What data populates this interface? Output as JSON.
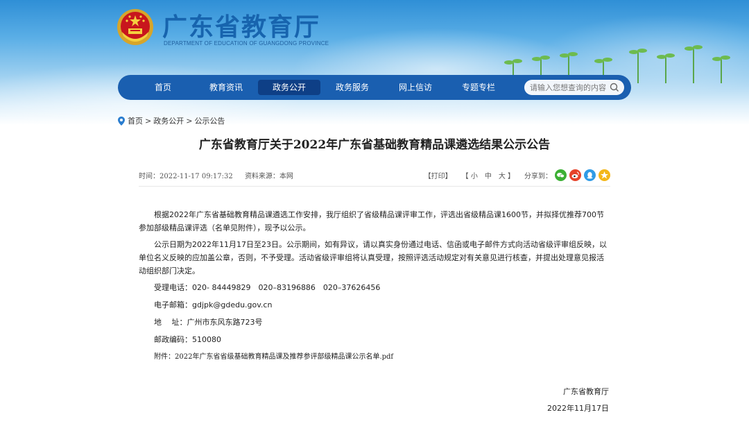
{
  "header": {
    "site_title": "广东省教育厅",
    "site_subtitle": "DEPARTMENT OF EDUCATION OF GUANGDONG PROVINCE"
  },
  "nav": {
    "items": [
      {
        "label": "首页",
        "active": false
      },
      {
        "label": "教育资讯",
        "active": false
      },
      {
        "label": "政务公开",
        "active": true
      },
      {
        "label": "政务服务",
        "active": false
      },
      {
        "label": "网上信访",
        "active": false
      },
      {
        "label": "专题专栏",
        "active": false
      }
    ],
    "search_placeholder": "请输入您想查询的内容"
  },
  "breadcrumb": {
    "items": [
      "首页",
      ">",
      "政务公开",
      ">",
      "公示公告"
    ]
  },
  "article": {
    "title": "广东省教育厅关于2022年广东省基础教育精品课遴选结果公示公告",
    "meta": {
      "time_label": "时间：",
      "time_value": "2022-11-17 09:17:32",
      "source_label": "资料来源：",
      "source_value": "本网",
      "print": "【打印】",
      "font_size": "【 小　中　大 】",
      "share_label": "分享到："
    },
    "paragraphs": [
      "根据2022年广东省基础教育精品课遴选工作安排，我厅组织了省级精品课评审工作，评选出省级精品课1600节，并拟择优推荐700节参加部级精品课评选（名单见附件），现予以公示。",
      "公示日期为2022年11月17日至23日。公示期间，如有异议，请以真实身份通过电话、信函或电子邮件方式向活动省级评审组反映，以单位名义反映的应加盖公章，否则，不予受理。活动省级评审组将认真受理，按照评选活动规定对有关意见进行核查，并提出处理意见报活动组织部门决定。"
    ],
    "contact": {
      "phone": "受理电话：020- 84449829　020–83196886　020–37626456",
      "email": "电子邮箱：gdjpk@gdedu.gov.cn",
      "address": "地　 址：广州市东风东路723号",
      "postcode": "邮政编码：510080"
    },
    "attachment_label": "附件：",
    "attachment_name": "2022年广东省省级基础教育精品课及推荐参评部级精品课公示名单.pdf",
    "signature": "广东省教育厅",
    "date": "2022年11月17日"
  },
  "colors": {
    "nav_bg": "#1a5fb0",
    "nav_active": "#0e3f86",
    "title_blue": "#1764ae",
    "wechat": "#3cb034",
    "weibo": "#e6432b",
    "qq": "#2f9be6",
    "qzone": "#f3b71a"
  },
  "share_icons": [
    "wechat-icon",
    "weibo-icon",
    "qq-icon",
    "qzone-icon"
  ]
}
